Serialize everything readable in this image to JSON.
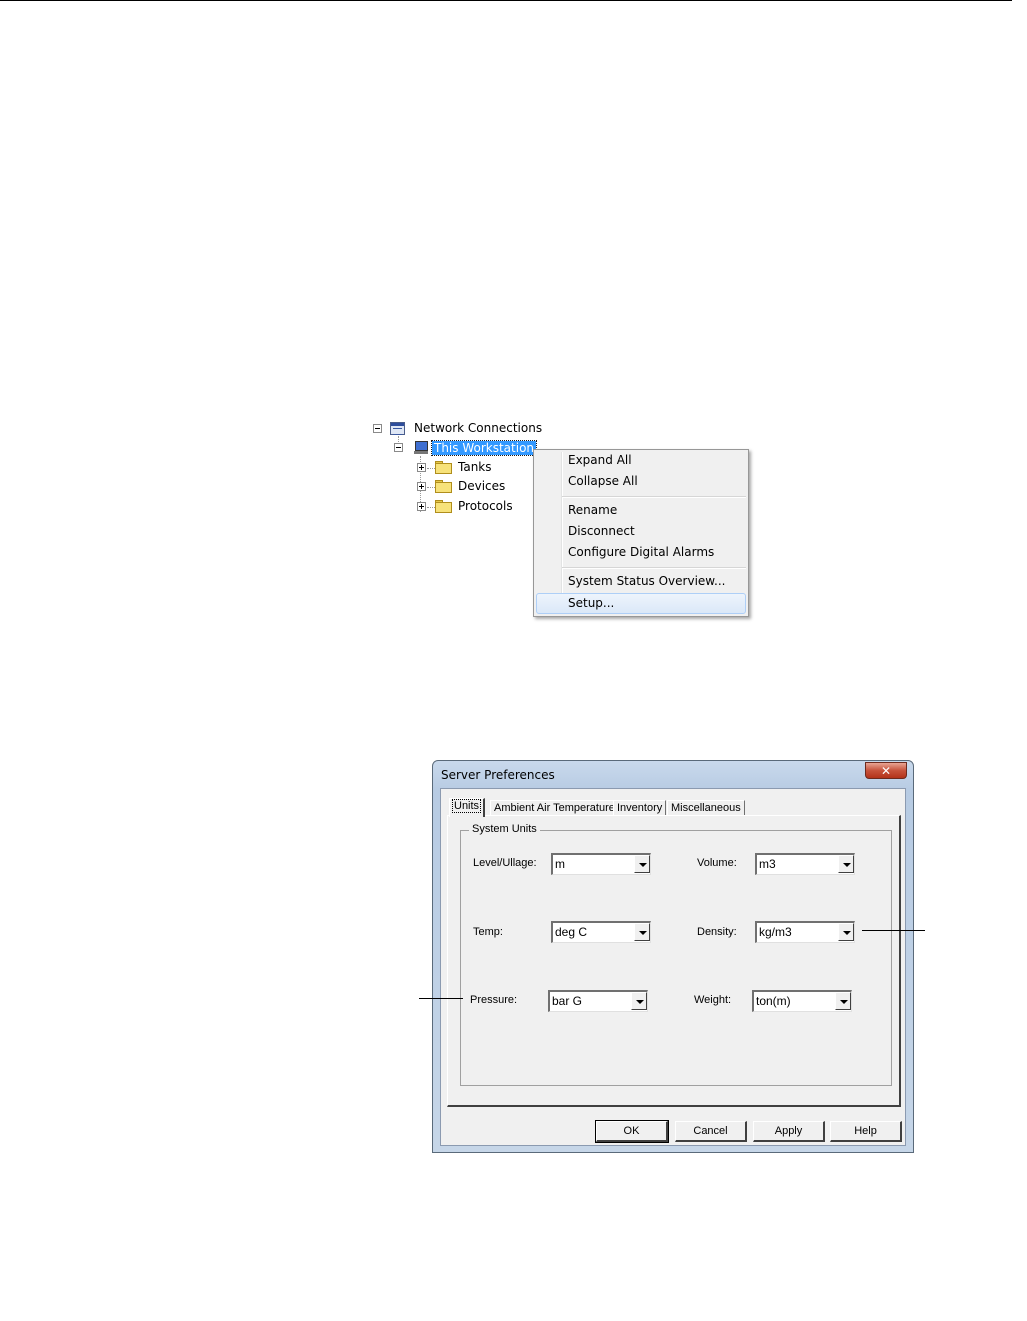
{
  "tree": {
    "root_label": "Network Connections",
    "workstation_label": "This Workstation",
    "children": [
      {
        "label": "Tanks"
      },
      {
        "label": "Devices"
      },
      {
        "label": "Protocols"
      }
    ]
  },
  "context_menu": {
    "items": [
      {
        "label": "Expand All"
      },
      {
        "label": "Collapse All"
      },
      {
        "label": "Rename"
      },
      {
        "label": "Disconnect"
      },
      {
        "label": "Configure Digital Alarms"
      },
      {
        "label": "System Status Overview..."
      },
      {
        "label": "Setup..."
      }
    ],
    "highlighted": "Setup..."
  },
  "dialog": {
    "title": "Server Preferences",
    "close_glyph": "✕",
    "tabs": [
      {
        "label": "Units"
      },
      {
        "label": "Ambient Air Temperature"
      },
      {
        "label": "Inventory"
      },
      {
        "label": "Miscellaneous"
      }
    ],
    "active_tab": "Units",
    "group_label": "System Units",
    "fields": {
      "level": {
        "label": "Level/Ullage:",
        "value": "m"
      },
      "volume": {
        "label": "Volume:",
        "value": "m3"
      },
      "temp": {
        "label": "Temp:",
        "value": "deg C"
      },
      "density": {
        "label": "Density:",
        "value": "kg/m3"
      },
      "pressure": {
        "label": "Pressure:",
        "value": "bar G"
      },
      "weight": {
        "label": "Weight:",
        "value": "ton(m)"
      }
    },
    "buttons": {
      "ok": "OK",
      "cancel": "Cancel",
      "apply": "Apply",
      "help": "Help"
    }
  },
  "colors": {
    "selection": "#3399ff",
    "menu_highlight": "#dbe8f8",
    "dialog_frame": "#b7cbe3",
    "close_button": "#c7523b"
  }
}
